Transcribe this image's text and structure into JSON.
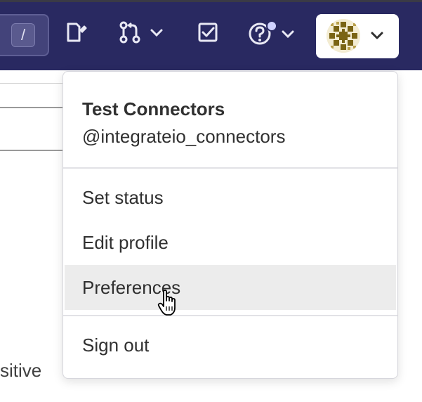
{
  "header": {
    "search_shortcut_key": "/",
    "icons": [
      "issues-icon",
      "merge-requests-icon",
      "todos-icon",
      "help-icon"
    ],
    "help_notification_dot": true
  },
  "background": {
    "partial_text": "sitive"
  },
  "user_menu": {
    "display_name": "Test Connectors",
    "username": "@integrateio_connectors",
    "items": [
      {
        "label": "Set status"
      },
      {
        "label": "Edit profile"
      },
      {
        "label": "Preferences",
        "hovered": true
      },
      {
        "label": "Sign out"
      }
    ]
  },
  "colors": {
    "header_bg": "#292961",
    "hover_bg": "#ececec",
    "text": "#303030"
  }
}
